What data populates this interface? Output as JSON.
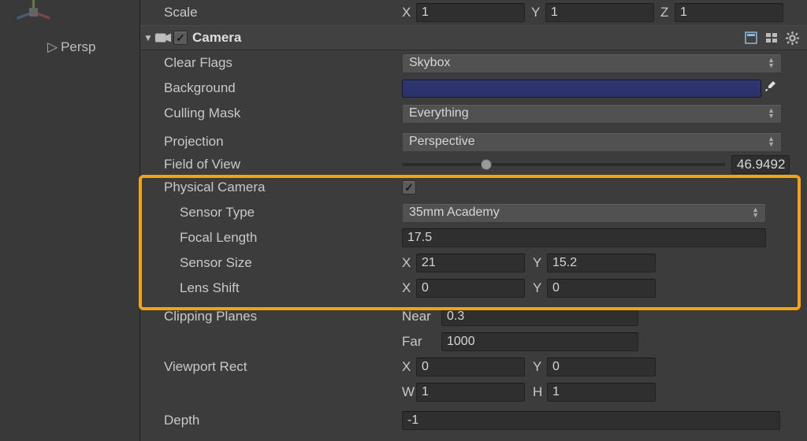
{
  "left": {
    "persp_label": "Persp"
  },
  "scale": {
    "label": "Scale",
    "x": "1",
    "y": "1",
    "z": "1"
  },
  "camera": {
    "title": "Camera",
    "enabled": true,
    "clear_flags": {
      "label": "Clear Flags",
      "value": "Skybox"
    },
    "background": {
      "label": "Background",
      "color": "#2e356e"
    },
    "culling_mask": {
      "label": "Culling Mask",
      "value": "Everything"
    },
    "projection": {
      "label": "Projection",
      "value": "Perspective"
    },
    "fov": {
      "label": "Field of View",
      "value": "46.9492"
    },
    "physical": {
      "label": "Physical Camera",
      "enabled": true
    },
    "sensor_type": {
      "label": "Sensor Type",
      "value": "35mm Academy"
    },
    "focal_length": {
      "label": "Focal Length",
      "value": "17.5"
    },
    "sensor_size": {
      "label": "Sensor Size",
      "x": "21",
      "y": "15.2"
    },
    "lens_shift": {
      "label": "Lens Shift",
      "x": "0",
      "y": "0"
    },
    "clipping": {
      "label": "Clipping Planes",
      "near_label": "Near",
      "near": "0.3",
      "far_label": "Far",
      "far": "1000"
    },
    "viewport": {
      "label": "Viewport Rect",
      "x": "0",
      "y": "0",
      "w": "1",
      "h": "1"
    },
    "depth": {
      "label": "Depth",
      "value": "-1"
    }
  },
  "axis": {
    "x": "X",
    "y": "Y",
    "z": "Z",
    "w": "W",
    "h": "H"
  }
}
